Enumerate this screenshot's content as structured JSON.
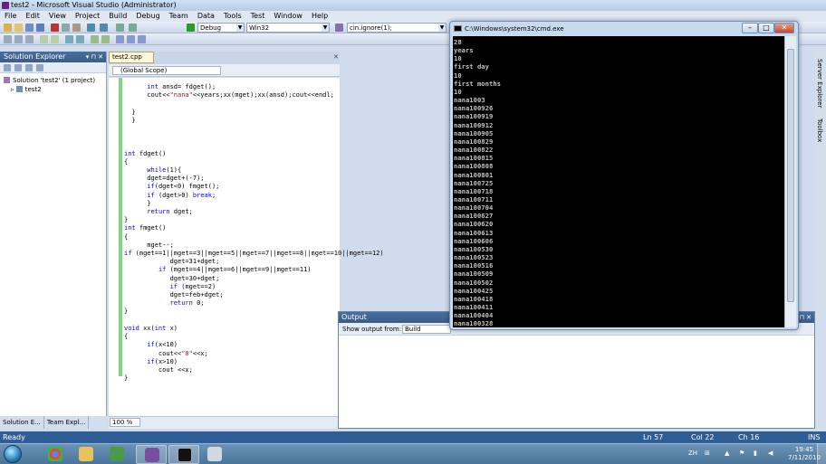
{
  "window": {
    "title": "test2 - Microsoft Visual Studio (Administrator)"
  },
  "menu": [
    "File",
    "Edit",
    "View",
    "Project",
    "Build",
    "Debug",
    "Team",
    "Data",
    "Tools",
    "Test",
    "Window",
    "Help"
  ],
  "toolbar": {
    "config": "Debug",
    "platform": "Win32",
    "find": "cin.ignore(1);"
  },
  "solution_explorer": {
    "title": "Solution Explorer",
    "pin": "▾ ⊓ ✕",
    "solution": "Solution 'test2' (1 project)",
    "project": "test2",
    "tabs": [
      "Solution E...",
      "Team Expl..."
    ]
  },
  "editor": {
    "tab": "test2.cpp",
    "close": "✕",
    "scope": "(Global Scope)",
    "zoom": "100 %"
  },
  "output": {
    "title": "Output",
    "pin": "▾ ⊓ ✕",
    "label": "Show output from:",
    "source": "Build"
  },
  "side_tabs": [
    "Server Explorer",
    "Toolbox"
  ],
  "status": {
    "state": "Ready",
    "ln": "Ln 57",
    "col": "Col 22",
    "ch": "Ch 16",
    "mode": "INS"
  },
  "cmd": {
    "title": "C:\\Windows\\system32\\cmd.exe",
    "lines": [
      "28",
      "years",
      "10",
      "first day",
      "10",
      "first months",
      "10",
      "nana1003",
      "nana100926",
      "nana100919",
      "nana100912",
      "nana100905",
      "nana100829",
      "nana100822",
      "nana100815",
      "nana100808",
      "nana100801",
      "nana100725",
      "nana100718",
      "nana100711",
      "nana100704",
      "nana100627",
      "nana100620",
      "nana100613",
      "nana100606",
      "nana100530",
      "nana100523",
      "nana100516",
      "nana100509",
      "nana100502",
      "nana100425",
      "nana100418",
      "nana100411",
      "nana100404",
      "nana100328"
    ]
  },
  "taskbar": {
    "lang": "ZH",
    "time": "19:45",
    "date": "7/11/2010"
  },
  "colors": {
    "status_bar": "#2f5d95",
    "panel_header": "#3a5b87",
    "keyword": "#0000ff",
    "string": "#a31515"
  }
}
